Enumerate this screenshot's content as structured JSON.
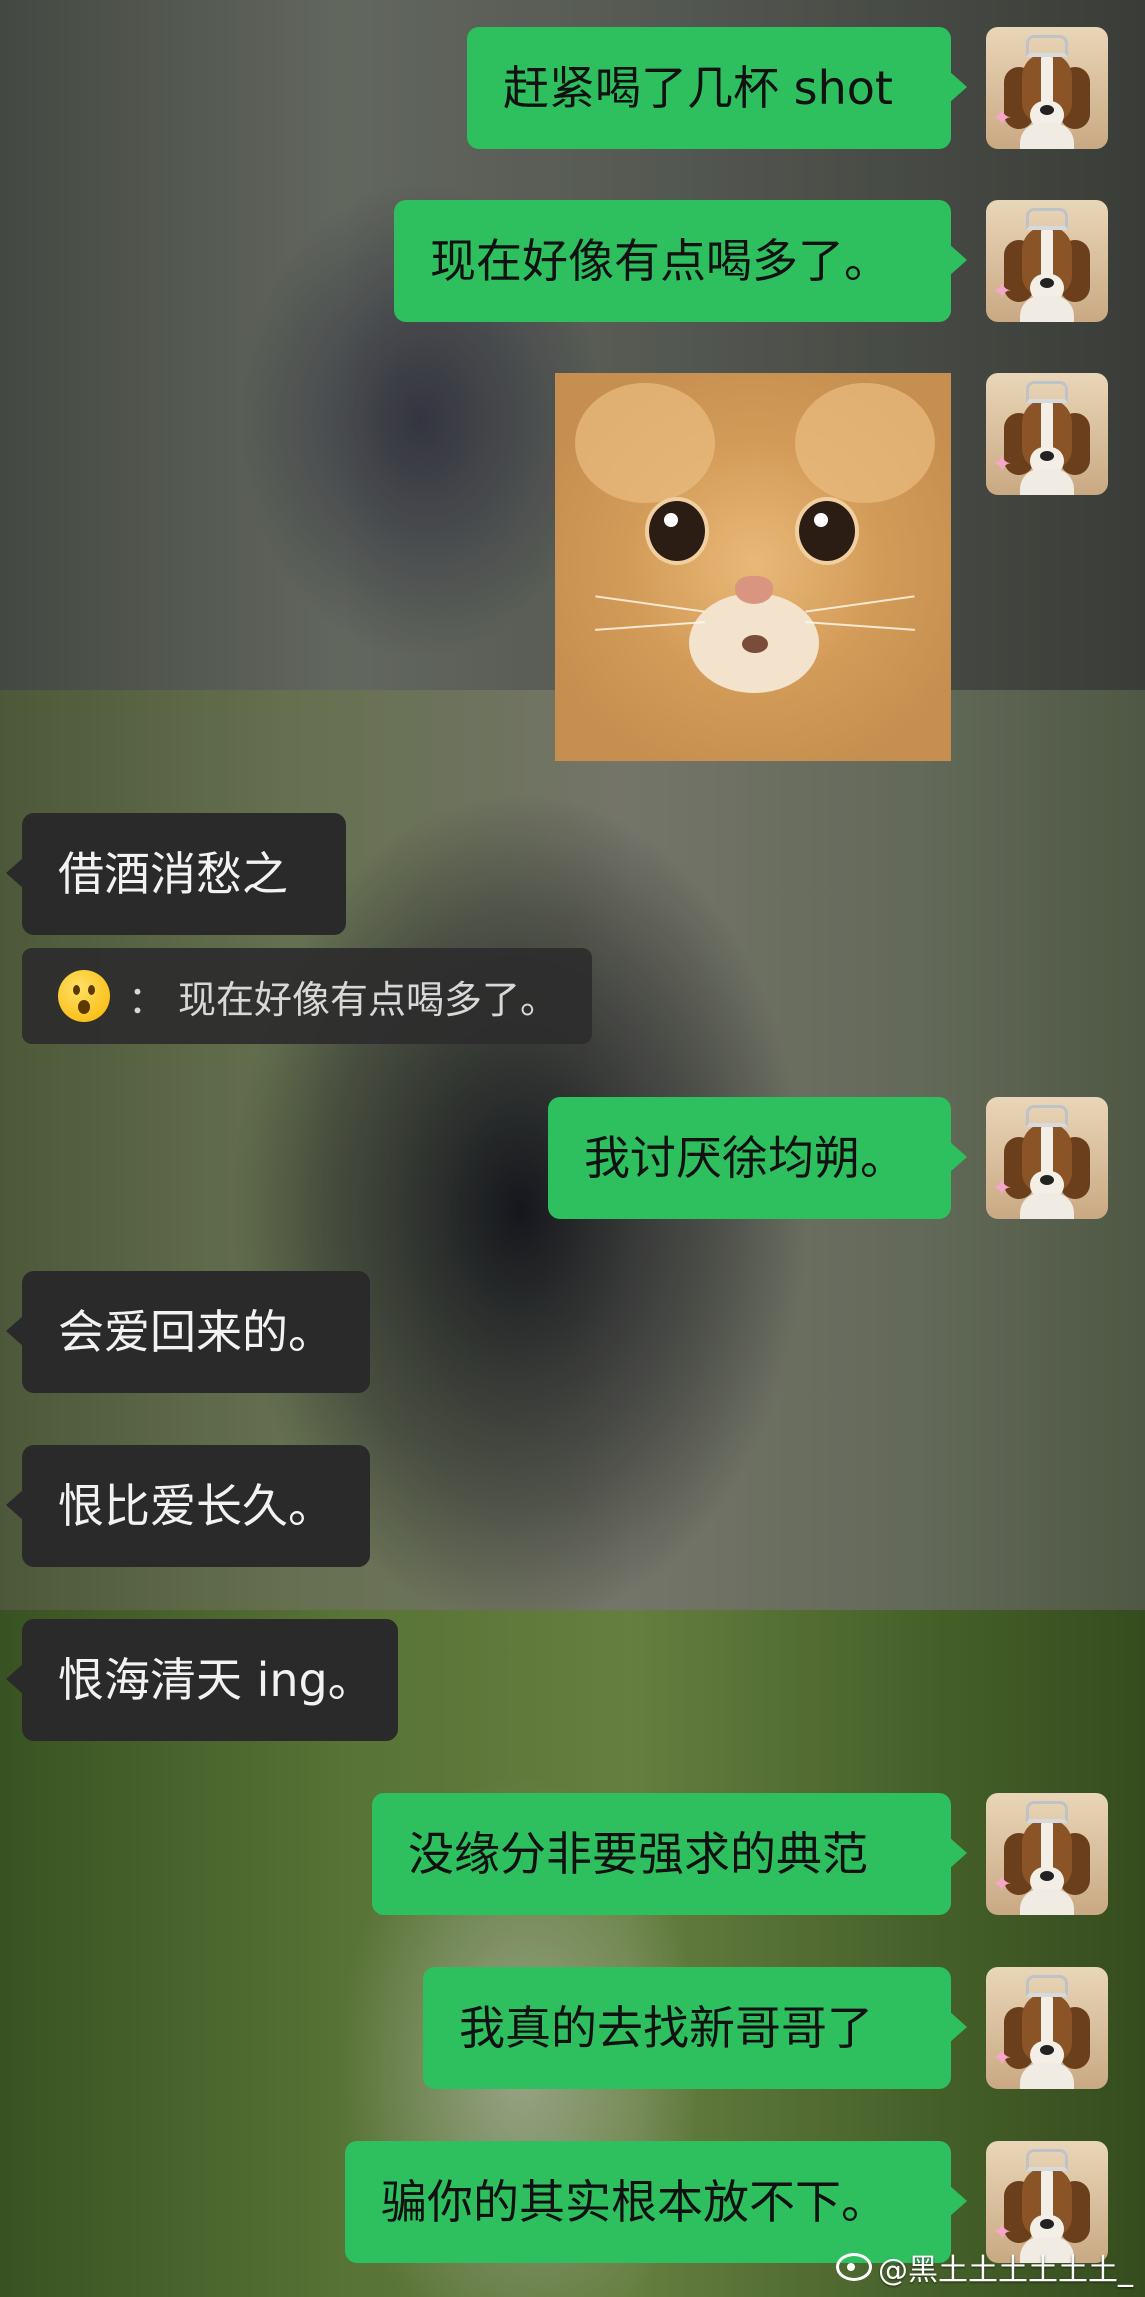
{
  "messages": [
    {
      "side": "out",
      "text": "赶紧喝了几杯 shot"
    },
    {
      "side": "out",
      "text": "现在好像有点喝多了。"
    },
    {
      "side": "out",
      "type": "sticker",
      "icon": "cat-face-sticker"
    },
    {
      "side": "in",
      "text": "借酒消愁之"
    },
    {
      "side": "in",
      "type": "quote",
      "icon": "surprised-face-emoji",
      "separator": "：",
      "text": "现在好像有点喝多了。"
    },
    {
      "side": "out",
      "text": "我讨厌徐均朔。"
    },
    {
      "side": "in",
      "text": "会爱回来的。"
    },
    {
      "side": "in",
      "text": "恨比爱长久。"
    },
    {
      "side": "in",
      "text": "恨海清天 ing。"
    },
    {
      "side": "out",
      "text": "没缘分非要强求的典范"
    },
    {
      "side": "out",
      "text": "我真的去找新哥哥了"
    },
    {
      "side": "out",
      "text": "骗你的其实根本放不下。"
    }
  ],
  "avatar_icon": "beagle-princess-avatar",
  "watermark": {
    "icon": "weibo-icon",
    "text": "@黑土土土土土土_"
  },
  "colors": {
    "outgoing_bubble": "#2ebf5f",
    "incoming_bubble": "#2a2a2a",
    "quote_bubble": "#2d2d2d"
  }
}
